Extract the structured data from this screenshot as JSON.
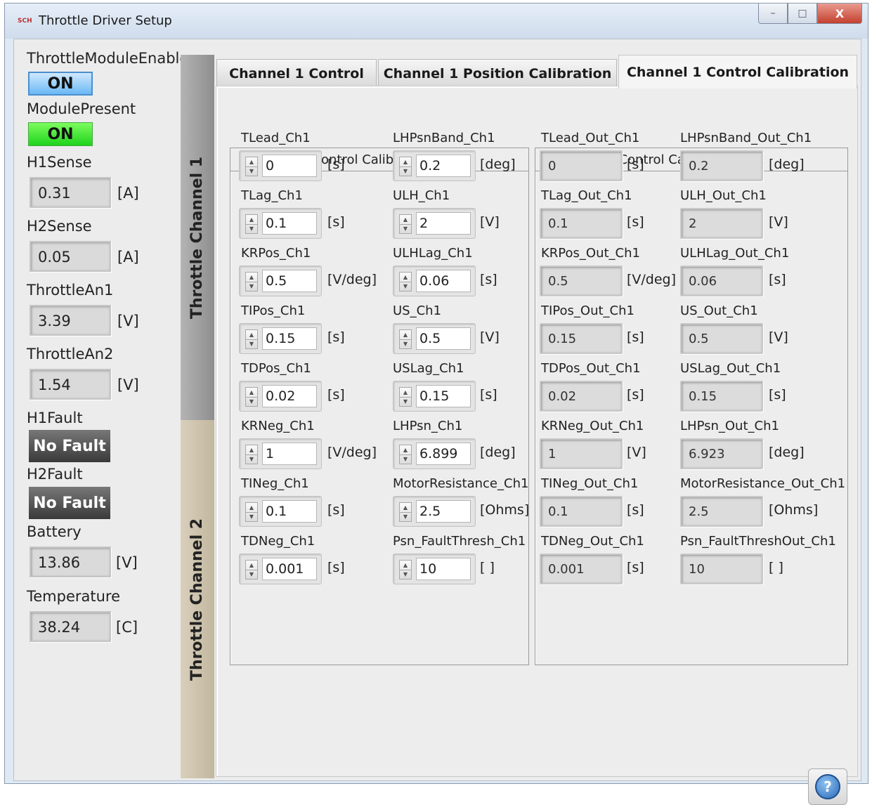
{
  "window": {
    "title": "Throttle Driver Setup",
    "app_icon": "SCH",
    "minimize": "–",
    "maximize": "□",
    "close": "X"
  },
  "left": {
    "module_enable": {
      "label": "ThrottleModuleEnable",
      "value": "ON"
    },
    "module_present": {
      "label": "ModulePresent",
      "value": "ON"
    },
    "h1sense": {
      "label": "H1Sense",
      "value": "0.31",
      "unit": "[A]"
    },
    "h2sense": {
      "label": "H2Sense",
      "value": "0.05",
      "unit": "[A]"
    },
    "throttle_an1": {
      "label": "ThrottleAn1",
      "value": "3.39",
      "unit": "[V]"
    },
    "throttle_an2": {
      "label": "ThrottleAn2",
      "value": "1.54",
      "unit": "[V]"
    },
    "h1fault": {
      "label": "H1Fault",
      "value": "No Fault"
    },
    "h2fault": {
      "label": "H2Fault",
      "value": "No Fault"
    },
    "battery": {
      "label": "Battery",
      "value": "13.86",
      "unit": "[V]"
    },
    "temperature": {
      "label": "Temperature",
      "value": "38.24",
      "unit": "[C]"
    }
  },
  "vtabs": {
    "ch1": "Throttle Channel 1",
    "ch2": "Throttle Channel 2"
  },
  "tabs": {
    "t1": "Channel 1 Control",
    "t2": "Channel 1 Position Calibration",
    "t3": "Channel 1 Control Calibration"
  },
  "in": {
    "title": "Control Calibration In",
    "c0": {
      "label": "TLead_Ch1",
      "value": "0",
      "unit": "[s]"
    },
    "c1": {
      "label": "TLag_Ch1",
      "value": "0.1",
      "unit": "[s]"
    },
    "c2": {
      "label": "KRPos_Ch1",
      "value": "0.5",
      "unit": "[V/deg]"
    },
    "c3": {
      "label": "TIPos_Ch1",
      "value": "0.15",
      "unit": "[s]"
    },
    "c4": {
      "label": "TDPos_Ch1",
      "value": "0.02",
      "unit": "[s]"
    },
    "c5": {
      "label": "KRNeg_Ch1",
      "value": "1",
      "unit": "[V/deg]"
    },
    "c6": {
      "label": "TINeg_Ch1",
      "value": "0.1",
      "unit": "[s]"
    },
    "c7": {
      "label": "TDNeg_Ch1",
      "value": "0.001",
      "unit": "[s]"
    },
    "d0": {
      "label": "LHPsnBand_Ch1",
      "value": "0.2",
      "unit": "[deg]"
    },
    "d1": {
      "label": "ULH_Ch1",
      "value": "2",
      "unit": "[V]"
    },
    "d2": {
      "label": "ULHLag_Ch1",
      "value": "0.06",
      "unit": "[s]"
    },
    "d3": {
      "label": "US_Ch1",
      "value": "0.5",
      "unit": "[V]"
    },
    "d4": {
      "label": "USLag_Ch1",
      "value": "0.15",
      "unit": "[s]"
    },
    "d5": {
      "label": "LHPsn_Ch1",
      "value": "6.899",
      "unit": "[deg]"
    },
    "d6": {
      "label": "MotorResistance_Ch1",
      "value": "2.5",
      "unit": "[Ohms]"
    },
    "d7": {
      "label": "Psn_FaultThresh_Ch1",
      "value": "10",
      "unit": "[ ]"
    }
  },
  "out": {
    "title": "Control Calibration Out",
    "c0": {
      "label": "TLead_Out_Ch1",
      "value": "0",
      "unit": "[s]"
    },
    "c1": {
      "label": "TLag_Out_Ch1",
      "value": "0.1",
      "unit": "[s]"
    },
    "c2": {
      "label": "KRPos_Out_Ch1",
      "value": "0.5",
      "unit": "[V/deg]"
    },
    "c3": {
      "label": "TIPos_Out_Ch1",
      "value": "0.15",
      "unit": "[s]"
    },
    "c4": {
      "label": "TDPos_Out_Ch1",
      "value": "0.02",
      "unit": "[s]"
    },
    "c5": {
      "label": "KRNeg_Out_Ch1",
      "value": "1",
      "unit": "[V]"
    },
    "c6": {
      "label": "TINeg_Out_Ch1",
      "value": "0.1",
      "unit": "[s]"
    },
    "c7": {
      "label": "TDNeg_Out_Ch1",
      "value": "0.001",
      "unit": "[s]"
    },
    "d0": {
      "label": "LHPsnBand_Out_Ch1",
      "value": "0.2",
      "unit": "[deg]"
    },
    "d1": {
      "label": "ULH_Out_Ch1",
      "value": "2",
      "unit": "[V]"
    },
    "d2": {
      "label": "ULHLag_Out_Ch1",
      "value": "0.06",
      "unit": "[s]"
    },
    "d3": {
      "label": "US_Out_Ch1",
      "value": "0.5",
      "unit": "[V]"
    },
    "d4": {
      "label": "USLag_Out_Ch1",
      "value": "0.15",
      "unit": "[s]"
    },
    "d5": {
      "label": "LHPsn_Out_Ch1",
      "value": "6.923",
      "unit": "[deg]"
    },
    "d6": {
      "label": "MotorResistance_Out_Ch1",
      "value": "2.5",
      "unit": "[Ohms]"
    },
    "d7": {
      "label": "Psn_FaultThreshOut_Ch1",
      "value": "10",
      "unit": "[ ]"
    }
  },
  "help": {
    "icon": "?"
  },
  "colors": {
    "on_blue": "#6ab8f5",
    "on_green": "#1ed31c",
    "fault_bg": "#3a3a3a",
    "tab_ch1": "#9e9e9e",
    "tab_ch2": "#c9bea8"
  }
}
